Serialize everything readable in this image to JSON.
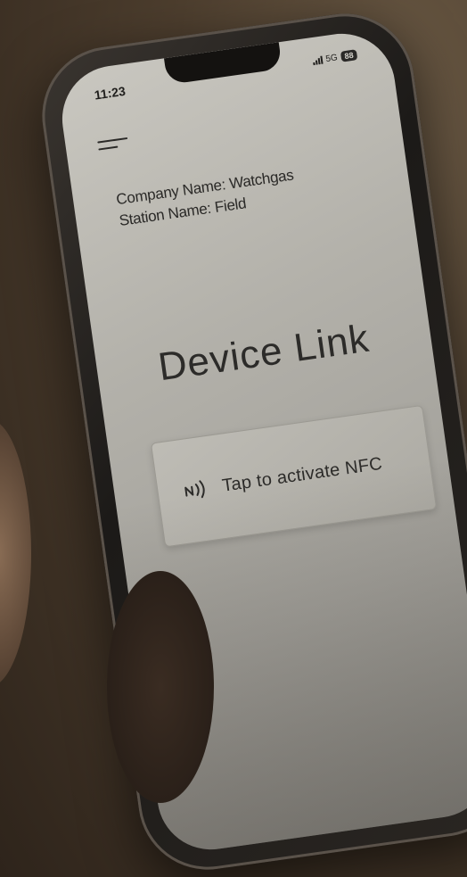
{
  "status_bar": {
    "time": "11:23",
    "network": "5G",
    "battery": "88"
  },
  "header": {
    "menu_icon": "hamburger-menu-icon"
  },
  "station_info": {
    "company_line": "Company Name: Watchgas",
    "station_line": "Station Name: Field"
  },
  "main": {
    "title": "Device Link",
    "nfc_button": {
      "icon": "nfc-icon",
      "label": "Tap to activate NFC"
    }
  }
}
